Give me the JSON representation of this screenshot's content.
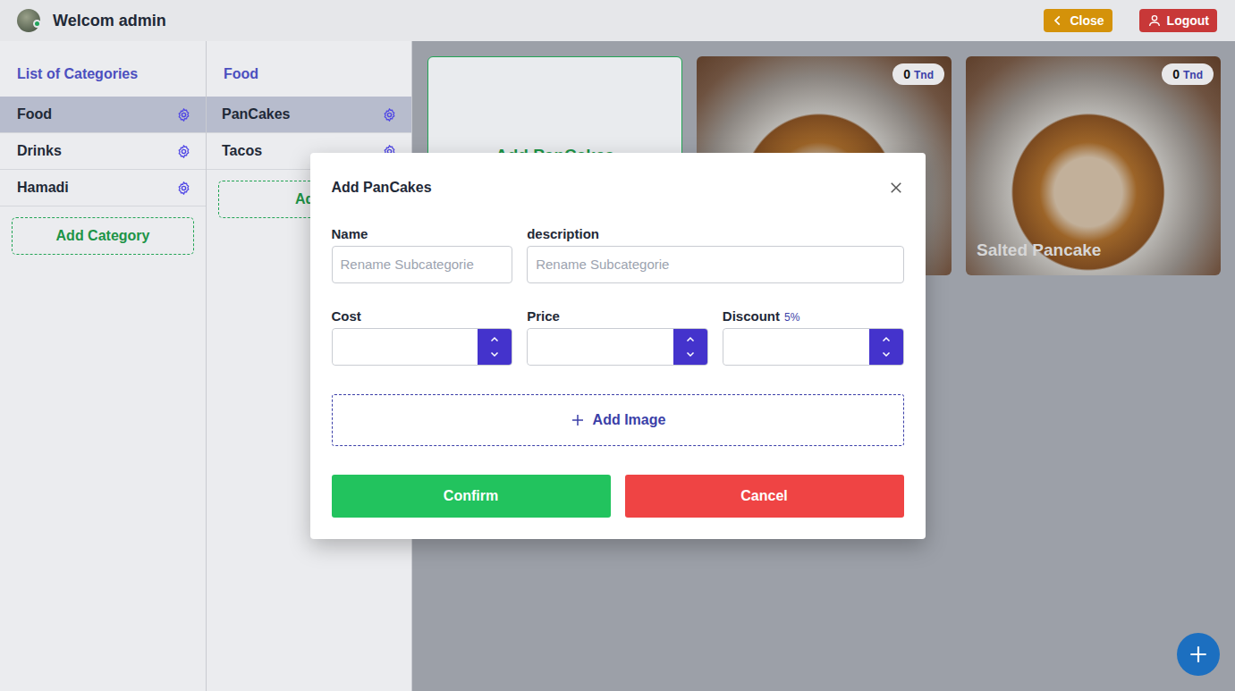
{
  "header": {
    "title": "Welcom admin",
    "close": "Close",
    "logout": "Logout"
  },
  "categories": {
    "title": "List of Categories",
    "items": [
      {
        "label": "Food",
        "selected": true
      },
      {
        "label": "Drinks",
        "selected": false
      },
      {
        "label": "Hamadi",
        "selected": false
      }
    ],
    "add_label": "Add Category"
  },
  "subcategories": {
    "title": "Food",
    "items": [
      {
        "label": "PanCakes",
        "selected": true
      },
      {
        "label": "Tacos",
        "selected": false
      }
    ],
    "add_label": "Add"
  },
  "products": {
    "add_label": "Add PanCakes",
    "items": [
      {
        "price": "0",
        "currency": "Tnd"
      },
      {
        "price": "0",
        "currency": "Tnd",
        "name": "Salted Pancake"
      }
    ]
  },
  "modal": {
    "title": "Add PanCakes",
    "name": {
      "label": "Name",
      "placeholder": "Rename Subcategorie"
    },
    "description": {
      "label": "description",
      "placeholder": "Rename Subcategorie"
    },
    "cost": {
      "label": "Cost"
    },
    "price": {
      "label": "Price"
    },
    "discount": {
      "label": "Discount",
      "hint": "5%"
    },
    "add_image": "Add Image",
    "confirm": "Confirm",
    "cancel": "Cancel"
  }
}
